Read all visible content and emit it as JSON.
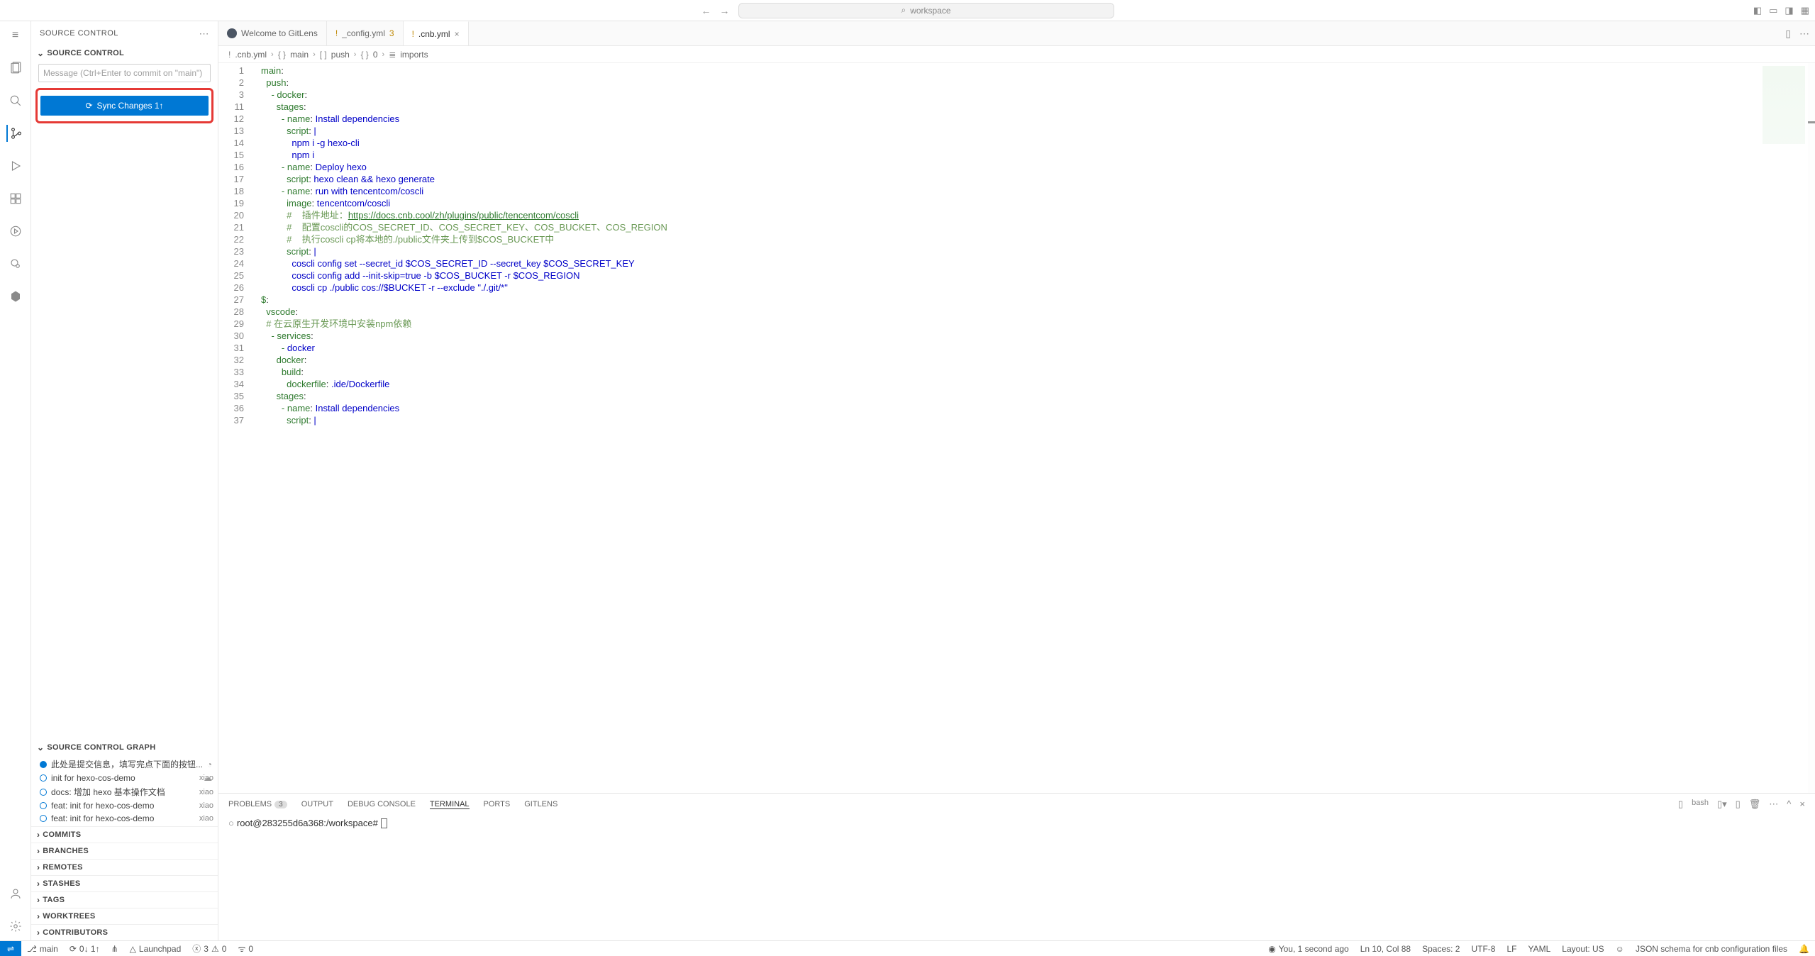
{
  "titlebar": {
    "search_placeholder": "workspace"
  },
  "sidebar": {
    "title": "SOURCE CONTROL",
    "section_sc": "SOURCE CONTROL",
    "commit_placeholder": "Message (Ctrl+Enter to commit on \"main\")",
    "sync_button": "Sync Changes 1↑",
    "section_graph": "SOURCE CONTROL GRAPH",
    "graph": [
      {
        "msg": "此处是提交信息，填写完点下面的按钮...",
        "author": "",
        "special": "current"
      },
      {
        "msg": "init for hexo-cos-demo",
        "author": "xiao",
        "special": "cloud"
      },
      {
        "msg": "docs: 增加 hexo 基本操作文档",
        "author": "xiao",
        "special": ""
      },
      {
        "msg": "feat: init for hexo-cos-demo",
        "author": "xiao",
        "special": ""
      },
      {
        "msg": "feat: init for hexo-cos-demo",
        "author": "xiao",
        "special": ""
      }
    ],
    "sections": [
      "COMMITS",
      "BRANCHES",
      "REMOTES",
      "STASHES",
      "TAGS",
      "WORKTREES",
      "CONTRIBUTORS"
    ]
  },
  "tabs": [
    {
      "label": "Welcome to GitLens",
      "icon": "gitlens",
      "active": false,
      "modified": false
    },
    {
      "label": "_config.yml",
      "icon": "warn",
      "active": false,
      "modified": true,
      "mod_count": "3"
    },
    {
      "label": ".cnb.yml",
      "icon": "warn",
      "active": true,
      "modified": false
    }
  ],
  "breadcrumb": [
    {
      "i": "!",
      "t": ".cnb.yml"
    },
    {
      "i": "{}",
      "t": "main"
    },
    {
      "i": "[ ]",
      "t": "push"
    },
    {
      "i": "{}",
      "t": "0"
    },
    {
      "i": "≣",
      "t": "imports"
    }
  ],
  "code": {
    "start_line": 1,
    "lines": [
      "main:",
      "  push:",
      "    - docker:",
      "      stages:",
      "        - name: Install dependencies",
      "          script: |",
      "            npm i -g hexo-cli",
      "            npm i",
      "        - name: Deploy hexo",
      "          script: hexo clean && hexo generate",
      "        - name: run with tencentcom/coscli",
      "          image: tencentcom/coscli",
      "          #    插件地址：https://docs.cnb.cool/zh/plugins/public/tencentcom/coscli",
      "          #    配置coscli的COS_SECRET_ID、COS_SECRET_KEY、COS_BUCKET、COS_REGION",
      "          #    执行coscli cp将本地的./public文件夹上传到$COS_BUCKET中",
      "          script: |",
      "            coscli config set --secret_id $COS_SECRET_ID --secret_key $COS_SECRET_KEY",
      "            coscli config add --init-skip=true -b $COS_BUCKET -r $COS_REGION",
      "            coscli cp ./public cos://$BUCKET -r --exclude \"./.git/*\"",
      "$:",
      "  vscode:",
      "  # 在云原生开发环境中安装npm依赖",
      "    - services:",
      "        - docker",
      "      docker:",
      "        build:",
      "          dockerfile: .ide/Dockerfile",
      "      stages:",
      "        - name: Install dependencies",
      "          script: |"
    ],
    "line_number_gap_at": 3,
    "gap_skip_to": 11
  },
  "panel": {
    "tabs": [
      {
        "label": "PROBLEMS",
        "badge": "3"
      },
      {
        "label": "OUTPUT"
      },
      {
        "label": "DEBUG CONSOLE"
      },
      {
        "label": "TERMINAL",
        "active": true
      },
      {
        "label": "PORTS"
      },
      {
        "label": "GITLENS"
      }
    ],
    "terminal_label": "bash",
    "prompt": "root@283255d6a368:/workspace#"
  },
  "status": {
    "branch": "main",
    "sync": "0↓ 1↑",
    "launchpad": "Launchpad",
    "errors": "3",
    "warnings": "0",
    "ports": "0",
    "blame": "You, 1 second ago",
    "position": "Ln 10, Col 88",
    "spaces": "Spaces: 2",
    "encoding": "UTF-8",
    "eol": "LF",
    "lang": "YAML",
    "layout": "Layout: US",
    "schema": "JSON schema for cnb configuration files"
  }
}
